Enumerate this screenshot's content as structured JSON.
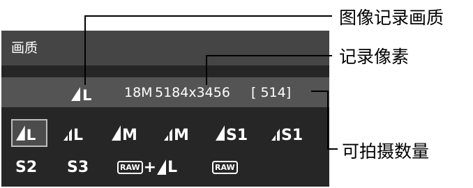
{
  "screen": {
    "title": "画质",
    "current": {
      "quality_icon": "large-fine-icon",
      "quality_size": "L",
      "megapixels": "18M",
      "resolution": "5184x3456",
      "shots": "[ 514]"
    },
    "options_row1": [
      {
        "label": "L",
        "icon": "fine-quality-icon",
        "selected": true
      },
      {
        "label": "L",
        "icon": "normal-quality-icon",
        "selected": false
      },
      {
        "label": "M",
        "icon": "fine-quality-icon",
        "selected": false
      },
      {
        "label": "M",
        "icon": "normal-quality-icon",
        "selected": false
      },
      {
        "label": "S1",
        "icon": "fine-quality-icon",
        "selected": false
      },
      {
        "label": "S1",
        "icon": "normal-quality-icon",
        "selected": false
      }
    ],
    "options_row2": [
      {
        "label": "S2"
      },
      {
        "label": "S3"
      },
      {
        "raw": "RAW",
        "plus": "+",
        "label": "L"
      },
      {
        "raw": "RAW"
      }
    ]
  },
  "callouts": {
    "image_quality": "图像记录画质",
    "pixels": "记录像素",
    "shots": "可拍摄数量"
  }
}
